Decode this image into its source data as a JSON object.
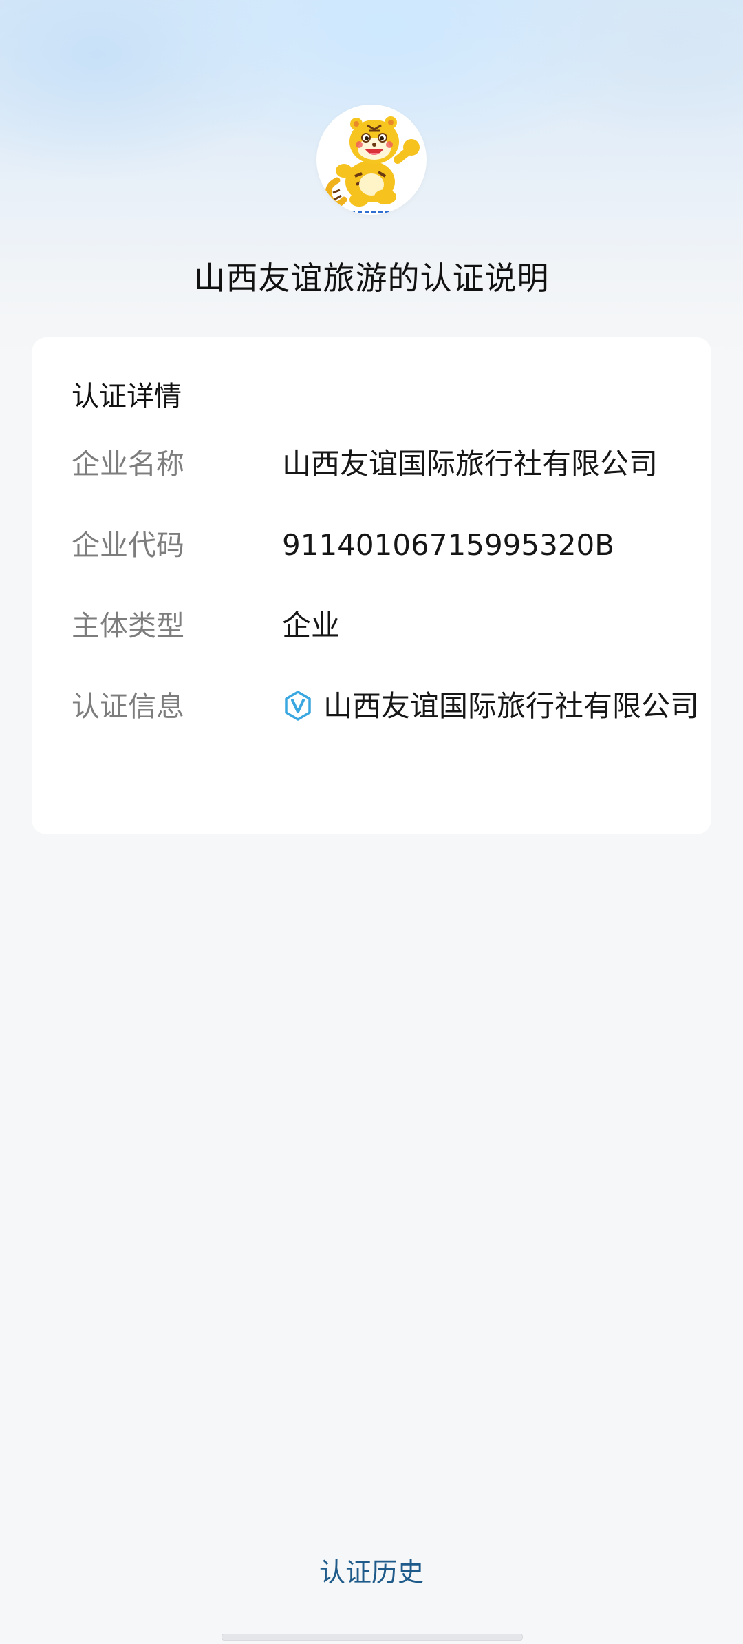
{
  "page": {
    "title": "山西友谊旅游的认证说明"
  },
  "avatar": {
    "icon": "tiger-mascot-logo"
  },
  "details": {
    "section_title": "认证详情",
    "rows": [
      {
        "label": "企业名称",
        "value": "山西友谊国际旅行社有限公司"
      },
      {
        "label": "企业代码",
        "value": "91140106715995320B"
      },
      {
        "label": "主体类型",
        "value": "企业"
      },
      {
        "label": "认证信息",
        "value": "山西友谊国际旅行社有限公司",
        "icon": "verified-v-icon"
      }
    ]
  },
  "footer": {
    "history_link": "认证历史"
  },
  "colors": {
    "accent_link": "#1f5b8a",
    "verified_icon": "#3aa7e0",
    "label_gray": "#7d7d7d"
  }
}
